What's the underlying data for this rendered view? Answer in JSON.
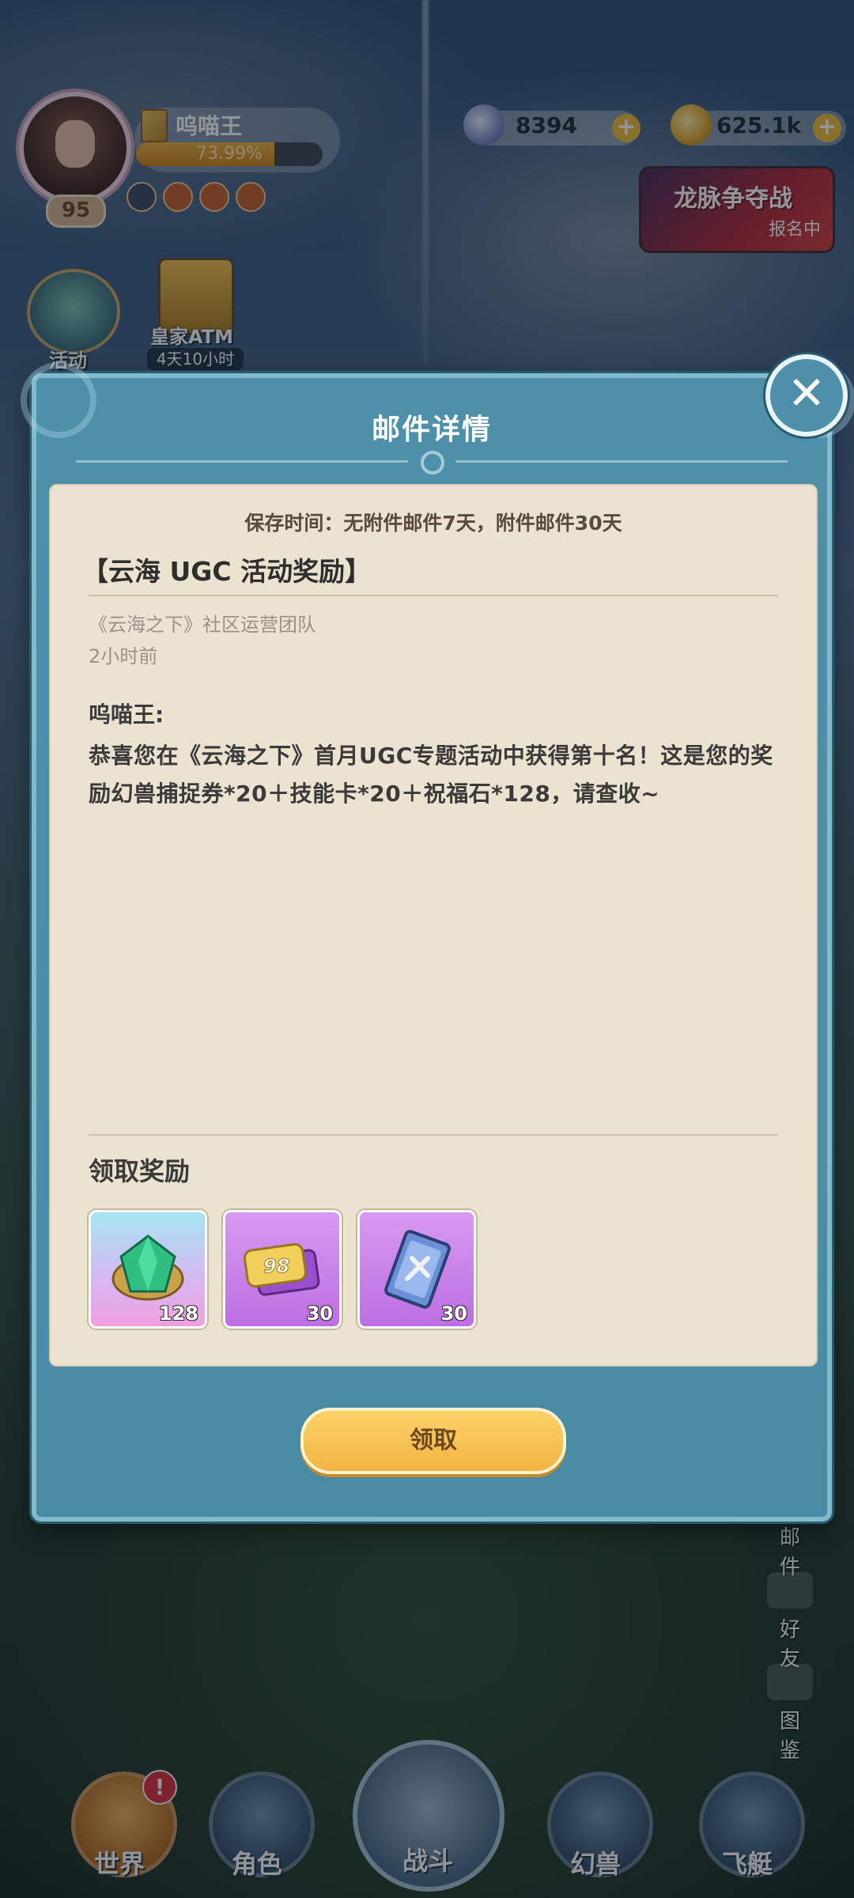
{
  "hud": {
    "player_name": "呜喵王",
    "level": "95",
    "exp_text": "73.99%",
    "exp_fraction": 0.74,
    "resources": {
      "gems": "8394",
      "gold": "625.1k"
    },
    "event_banner": {
      "title": "龙脉争夺战",
      "status": "报名中"
    },
    "activity_label": "活动",
    "atm_label": "皇家ATM",
    "atm_timer": "4天10小时"
  },
  "modal": {
    "title": "邮件详情",
    "retention_note": "保存时间：无附件邮件7天，附件邮件30天",
    "subject": "【云海 UGC 活动奖励】",
    "sender": "《云海之下》社区运营团队",
    "time": "2小时前",
    "greeting": "呜喵王:",
    "body": "恭喜您在《云海之下》首月UGC专题活动中获得第十名！这是您的奖励幻兽捕捉券*20＋技能卡*20＋祝福石*128，请查收~",
    "reward_title": "领取奖励",
    "rewards": [
      {
        "icon": "green-gem-icon",
        "qty": "128"
      },
      {
        "icon": "ticket-icon",
        "badge_text": "98",
        "qty": "30"
      },
      {
        "icon": "skill-card-icon",
        "qty": "30"
      }
    ],
    "claim_label": "领取",
    "close_icon": "close-icon"
  },
  "right_menu": [
    {
      "label": "邮件",
      "icon": "mail-icon"
    },
    {
      "label": "好友",
      "icon": "friends-icon"
    },
    {
      "label": "图鉴",
      "icon": "book-icon"
    }
  ],
  "bottom_nav": [
    {
      "label": "世界",
      "icon": "world-icon"
    },
    {
      "label": "角色",
      "icon": "character-icon"
    },
    {
      "label": "战斗",
      "icon": "battle-icon"
    },
    {
      "label": "幻兽",
      "icon": "beast-icon"
    },
    {
      "label": "飞艇",
      "icon": "airship-icon"
    }
  ],
  "notification_badge": "!",
  "colors": {
    "modal_bg": "#4e90a9",
    "card_bg": "#ece2d0",
    "claim_button": "#f3b441",
    "accent_red": "#e0313c"
  }
}
